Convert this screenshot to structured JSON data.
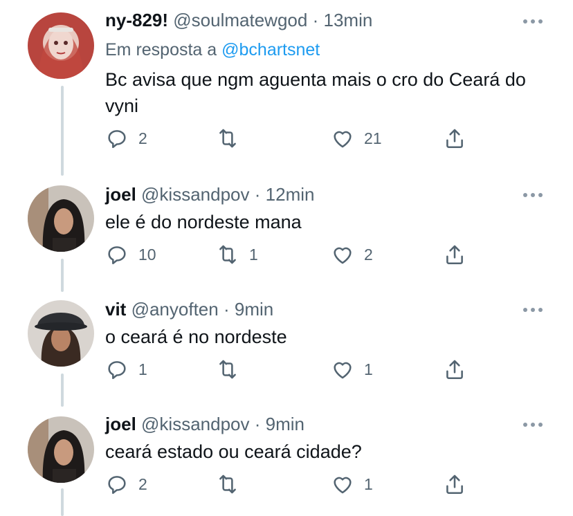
{
  "tweets": [
    {
      "name": "ny-829!",
      "handle": "@soulmatewgod",
      "sep": "·",
      "time": "13min",
      "reply_prefix": "Em resposta a",
      "reply_mention": "@bchartsnet",
      "text": "Bc avisa que ngm aguenta mais o cro do Ceará do vyni",
      "replies": "2",
      "retweets": "",
      "likes": "21"
    },
    {
      "name": "joel",
      "handle": "@kissandpov",
      "sep": "·",
      "time": "12min",
      "text": "ele é do nordeste mana",
      "replies": "10",
      "retweets": "1",
      "likes": "2"
    },
    {
      "name": "vit",
      "handle": "@anyoften",
      "sep": "·",
      "time": "9min",
      "text": "o ceará é no nordeste",
      "replies": "1",
      "retweets": "",
      "likes": "1"
    },
    {
      "name": "joel",
      "handle": "@kissandpov",
      "sep": "·",
      "time": "9min",
      "text": "ceará estado ou ceará cidade?",
      "replies": "2",
      "retweets": "",
      "likes": "1"
    }
  ],
  "icons": {
    "reply": "reply-icon",
    "retweet": "retweet-icon",
    "like": "heart-icon",
    "share": "share-icon",
    "more": "more-icon"
  },
  "colors": {
    "text": "#0f1419",
    "secondary": "#536471",
    "link": "#1d9bf0",
    "thread_line": "#cfd9de"
  }
}
